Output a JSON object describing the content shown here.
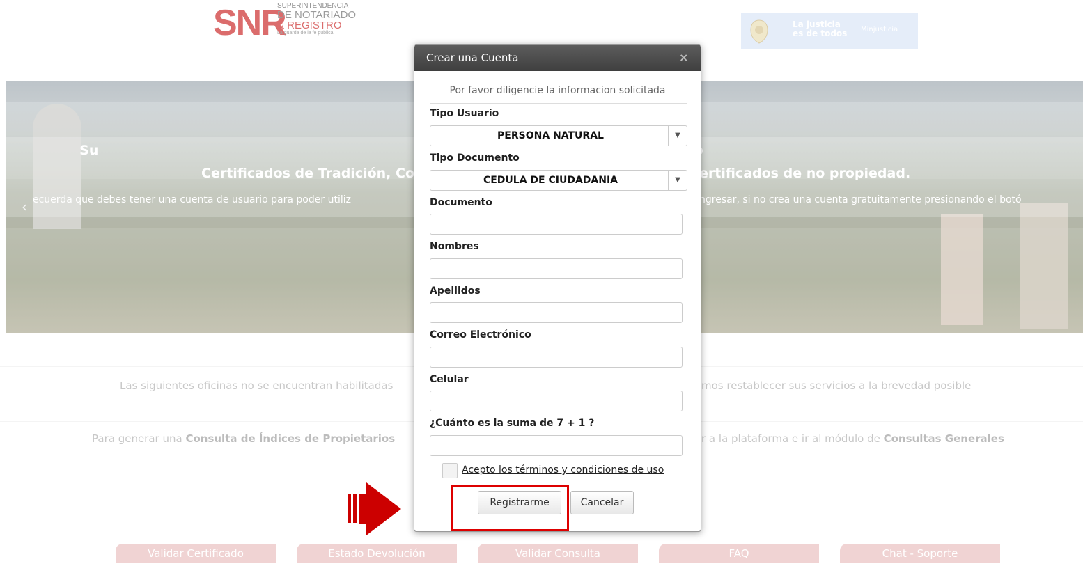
{
  "header": {
    "snr": {
      "big": "SNR",
      "line1": "SUPERINTENDENCIA",
      "line2": "DE NOTARIADO",
      "line3": "& REGISTRO",
      "line4": "La guarda de la fe pública"
    },
    "minjusticia": {
      "slogan_1": "La justicia",
      "slogan_2": "es de todos",
      "right": "Minjusticia"
    }
  },
  "banner": {
    "line1": "Su",
    "line1_right": "ro",
    "line2_left": "Certificados de Tradición, Co",
    "line2_right": "ertificados de no propiedad.",
    "line3_left": "ecuerda que debes tener una cuenta de usuario para poder utiliz",
    "line3_right": "ngresar, si no crea una cuenta gratuitamente presionando el botó",
    "prev_arrow": "‹"
  },
  "notice": {
    "left": "Las siguientes oficinas no se encuentran habilitadas",
    "right": "mos restablecer sus servicios a la brevedad posible"
  },
  "info": {
    "left_prefix": "Para generar una ",
    "left_bold": "Consulta de Índices de Propietarios",
    "right_prefix": "r a la plataforma e ir al módulo de ",
    "right_bold": "Consultas Generales"
  },
  "bottom_buttons": [
    "Validar Certificado",
    "Estado Devolución",
    "Validar Consulta",
    "FAQ",
    "Chat - Soporte"
  ],
  "modal": {
    "title": "Crear una Cuenta",
    "close": "×",
    "subtitle": "Por favor diligencie la informacion solicitada",
    "tipo_usuario": {
      "label": "Tipo Usuario",
      "value": "PERSONA NATURAL"
    },
    "tipo_documento": {
      "label": "Tipo Documento",
      "value": "CEDULA DE CIUDADANIA"
    },
    "documento": {
      "label": "Documento",
      "value": ""
    },
    "nombres": {
      "label": "Nombres",
      "value": ""
    },
    "apellidos": {
      "label": "Apellidos",
      "value": ""
    },
    "correo": {
      "label": "Correo Electrónico",
      "value": ""
    },
    "celular": {
      "label": "Celular",
      "value": ""
    },
    "captcha": {
      "label": "¿Cuánto es la suma de 7 + 1 ?",
      "value": ""
    },
    "terms": "Acepto los términos y condiciones de uso",
    "register": "Registrarme",
    "cancel": "Cancelar"
  },
  "colors": {
    "accent_red": "#cc0000",
    "modal_header": "#4a4a4a",
    "bottom_button": "#e9bcbc"
  }
}
